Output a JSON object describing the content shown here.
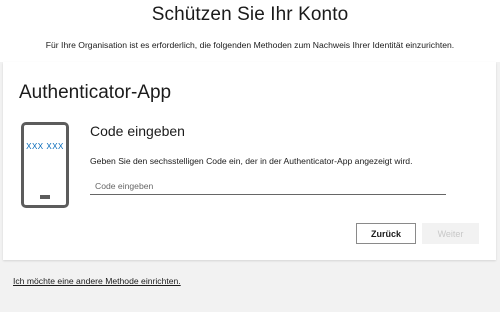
{
  "header": {
    "title": "Schützen Sie Ihr Konto",
    "subtitle": "Für Ihre Organisation ist es erforderlich, die folgenden Methoden zum Nachweis Ihrer Identität einzurichten."
  },
  "card": {
    "title": "Authenticator-App",
    "phone_code": "XXX XXX",
    "heading": "Code eingeben",
    "description": "Geben Sie den sechsstelligen Code ein, der in der Authenticator-App angezeigt wird.",
    "input": {
      "placeholder": "Code eingeben",
      "value": ""
    },
    "buttons": {
      "back": "Zurück",
      "next": "Weiter"
    }
  },
  "footer": {
    "other_method_link": "Ich möchte eine andere Methode einrichten."
  },
  "colors": {
    "accent": "#0067b8",
    "background": "#f2f2f2",
    "card": "#ffffff"
  }
}
